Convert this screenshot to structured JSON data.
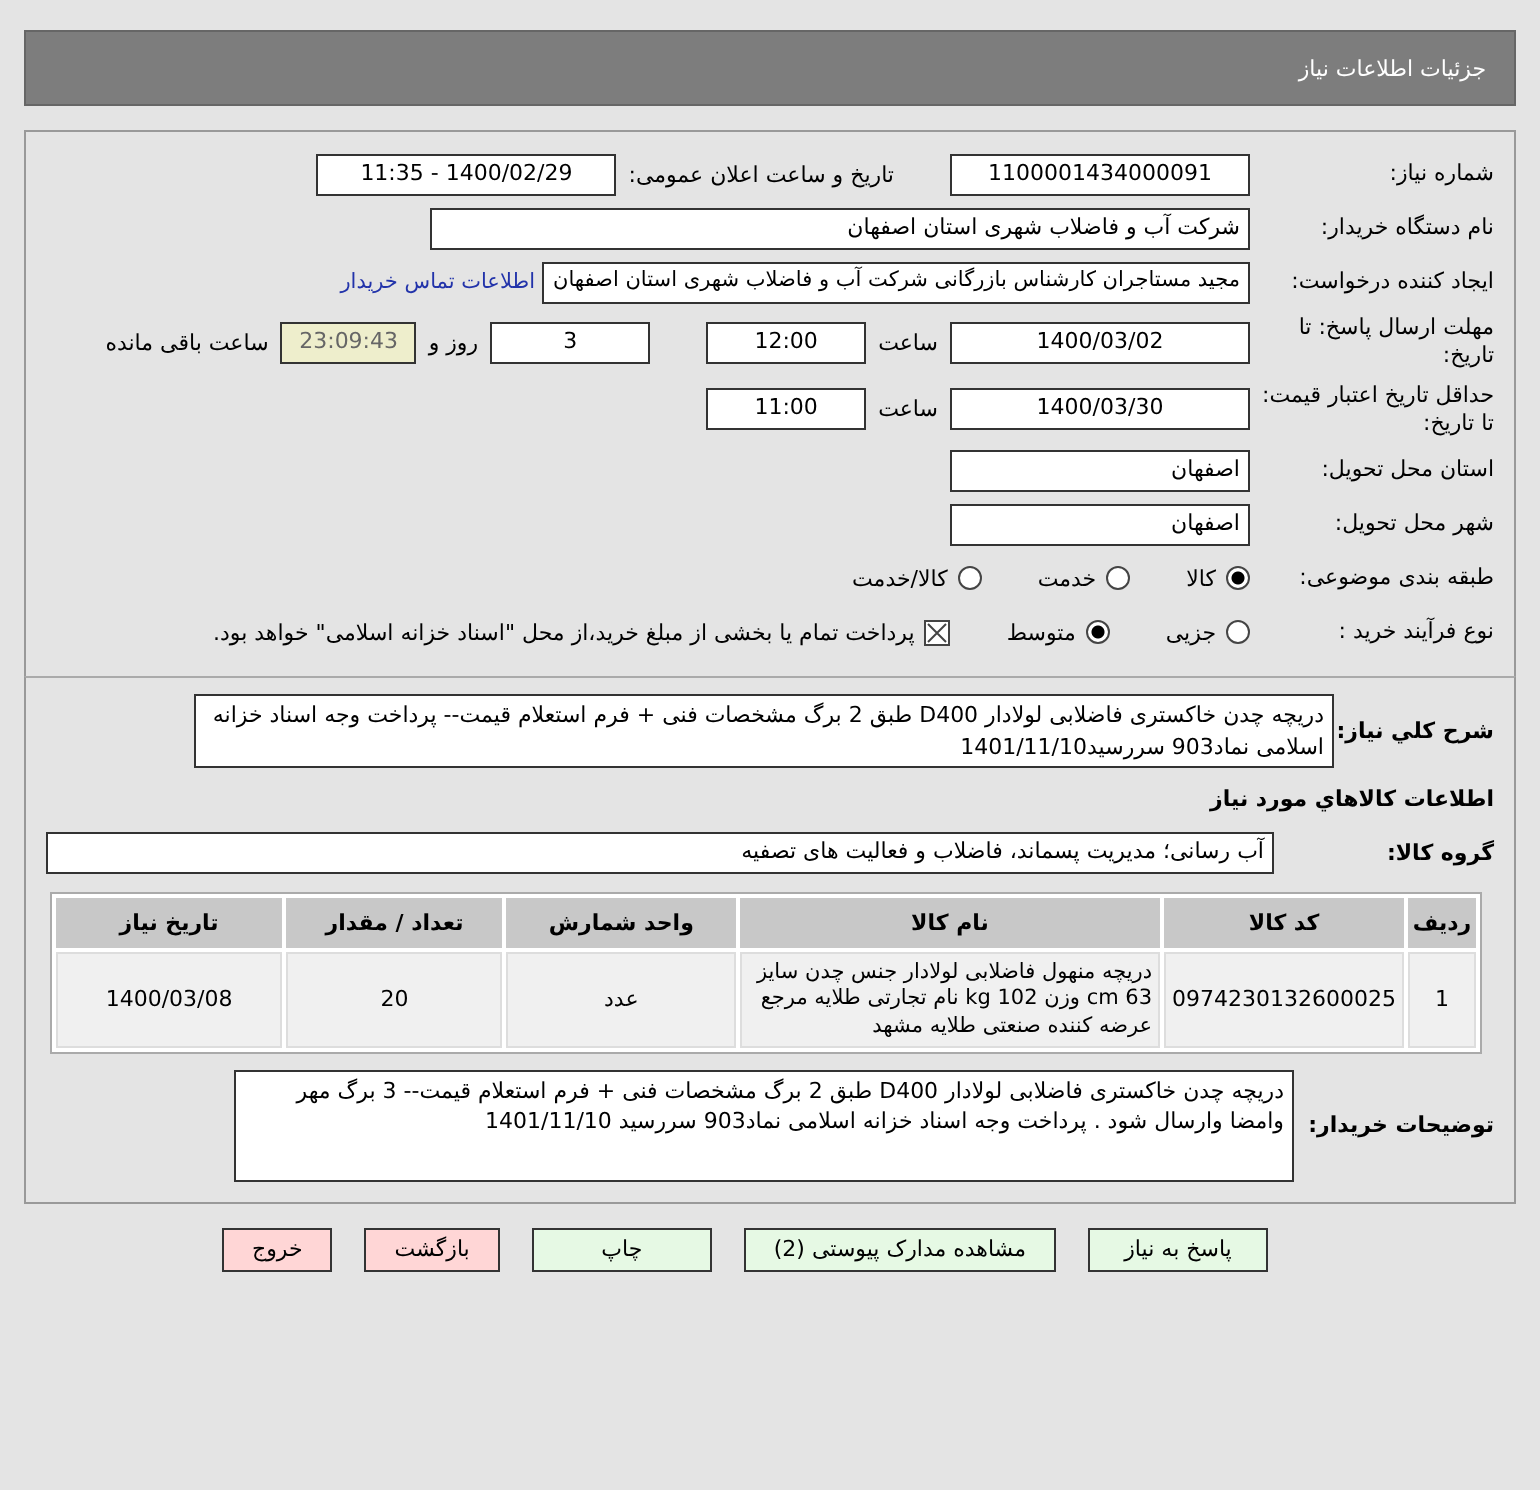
{
  "header": {
    "title": "جزئیات اطلاعات نیاز"
  },
  "need_number": {
    "label": "شماره نیاز:",
    "value": "1100001434000091"
  },
  "announce": {
    "label": "تاریخ و ساعت اعلان عمومی:",
    "value": "1400/02/29 - 11:35"
  },
  "buyer_org": {
    "label": "نام دستگاه خریدار:",
    "value": "شرکت آب و فاضلاب شهری استان اصفهان"
  },
  "requester": {
    "label": "ایجاد کننده درخواست:",
    "value": "مجید مستاجران کارشناس بازرگانی شرکت آب و فاضلاب شهری استان اصفهان",
    "link": "اطلاعات تماس خریدار"
  },
  "deadline": {
    "label": "مهلت ارسال پاسخ: تا تاریخ:",
    "date": "1400/03/02",
    "time_label": "ساعت",
    "time": "12:00",
    "days": "3",
    "days_label": "روز و",
    "remaining": "23:09:43",
    "remaining_label": "ساعت باقی مانده"
  },
  "validity": {
    "label": "حداقل تاریخ اعتبار قیمت: تا تاریخ:",
    "date": "1400/03/30",
    "time_label": "ساعت",
    "time": "11:00"
  },
  "province": {
    "label": "استان محل تحویل:",
    "value": "اصفهان"
  },
  "city": {
    "label": "شهر محل تحویل:",
    "value": "اصفهان"
  },
  "category": {
    "label": "طبقه بندی موضوعی:",
    "options": [
      {
        "label": "کالا",
        "selected": true
      },
      {
        "label": "خدمت",
        "selected": false
      },
      {
        "label": "کالا/خدمت",
        "selected": false
      }
    ]
  },
  "process": {
    "label": "نوع فرآیند خرید :",
    "options": [
      {
        "label": "جزیی",
        "selected": false
      },
      {
        "label": "متوسط",
        "selected": true
      }
    ],
    "payment": {
      "checked": true,
      "text": "پرداخت تمام یا بخشی از مبلغ خرید،از محل \"اسناد خزانه اسلامی\" خواهد بود."
    }
  },
  "description": {
    "label": "شرح کلي نياز:",
    "value": "دریچه چدن خاکستری فاضلابی لولادار D400  طبق 2 برگ مشخصات فنی + فرم استعلام قیمت-- پرداخت وجه اسناد خزانه اسلامی نماد903 سررسید1401/11/10"
  },
  "goods_title": "اطلاعات کالاهاي مورد نياز",
  "goods_group": {
    "label": "گروه کالا:",
    "value": "آب رسانی؛ مدیریت پسماند، فاضلاب و فعالیت های تصفیه"
  },
  "table": {
    "columns": [
      "ردیف",
      "کد کالا",
      "نام کالا",
      "واحد شمارش",
      "تعداد / مقدار",
      "تاریخ نیاز"
    ],
    "rows": [
      {
        "cells": [
          "1",
          "0974230132600025",
          "دریچه منهول فاضلابی لولادار جنس چدن سایز 63 cm وزن 102 kg نام تجارتی طلایه مرجع عرضه کننده صنعتی طلایه مشهد",
          "عدد",
          "20",
          "1400/03/08"
        ]
      }
    ]
  },
  "buyer_notes": {
    "label": "توضیحات خریدار:",
    "value": "دریچه چدن خاکستری فاضلابی لولادار D400  طبق 2 برگ مشخصات فنی + فرم استعلام قیمت-- 3 برگ مهر وامضا وارسال شود . پرداخت وجه اسناد خزانه اسلامی نماد903 سررسید 1401/11/10"
  },
  "buttons": [
    {
      "label": "پاسخ به نیاز",
      "kind": "action"
    },
    {
      "label": "مشاهده مدارک پیوستی (2)",
      "kind": "action"
    },
    {
      "label": "چاپ",
      "kind": "action"
    },
    {
      "label": "بازگشت",
      "kind": "exit"
    },
    {
      "label": "خروج",
      "kind": "exit"
    }
  ]
}
